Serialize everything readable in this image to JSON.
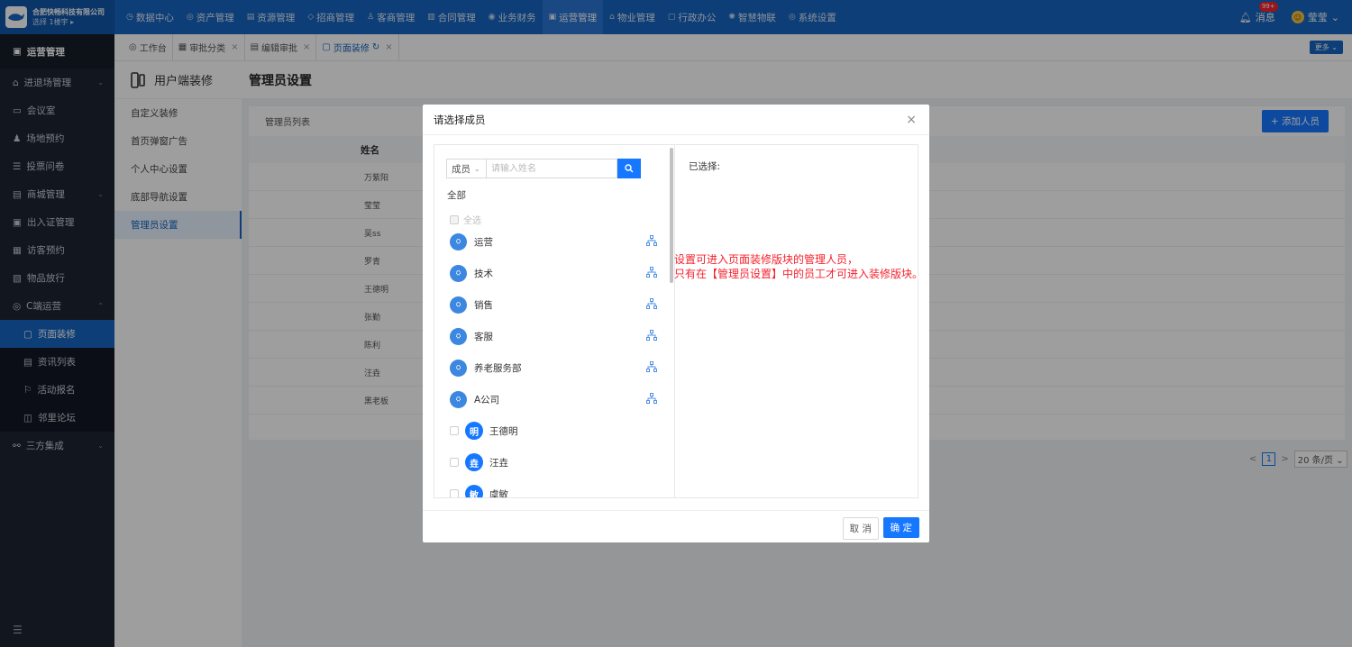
{
  "app": {
    "company": "合肥快畅科技有限公司",
    "building": "选择 1楼宇 ▸"
  },
  "topnav": {
    "items": [
      {
        "icon": "◷",
        "label": "数据中心"
      },
      {
        "icon": "◎",
        "label": "资产管理"
      },
      {
        "icon": "▤",
        "label": "资源管理"
      },
      {
        "icon": "◇",
        "label": "招商管理"
      },
      {
        "icon": "♙",
        "label": "客商管理"
      },
      {
        "icon": "▥",
        "label": "合同管理"
      },
      {
        "icon": "◉",
        "label": "业务财务"
      },
      {
        "icon": "▣",
        "label": "运营管理"
      },
      {
        "icon": "⌂",
        "label": "物业管理"
      },
      {
        "icon": "▢",
        "label": "行政办公"
      },
      {
        "icon": "✺",
        "label": "智慧物联"
      },
      {
        "icon": "◎",
        "label": "系统设置"
      }
    ],
    "active_index": 7,
    "messages_label": "消息",
    "messages_badge": "99+",
    "user_name": "莹莹"
  },
  "sidebar": {
    "header": "运营管理",
    "items": [
      {
        "icon": "⌂",
        "label": "进退场管理",
        "chevron": "⌄"
      },
      {
        "icon": "▭",
        "label": "会议室"
      },
      {
        "icon": "♟",
        "label": "场地预约"
      },
      {
        "icon": "☰",
        "label": "投票问卷"
      },
      {
        "icon": "▤",
        "label": "商城管理",
        "chevron": "⌄"
      },
      {
        "icon": "▣",
        "label": "出入证管理"
      },
      {
        "icon": "▦",
        "label": "访客预约"
      },
      {
        "icon": "▧",
        "label": "物品放行"
      },
      {
        "icon": "◎",
        "label": "C端运营",
        "chevron": "⌃"
      },
      {
        "icon": "▢",
        "label": "页面装修",
        "sub": true,
        "active": true
      },
      {
        "icon": "▤",
        "label": "资讯列表",
        "sub": true
      },
      {
        "icon": "⚐",
        "label": "活动报名",
        "sub": true
      },
      {
        "icon": "◫",
        "label": "邻里论坛",
        "sub": true
      },
      {
        "icon": "⚯",
        "label": "三方集成",
        "chevron": "⌄"
      }
    ],
    "bottom_icon": "☰"
  },
  "tabs": {
    "items": [
      {
        "icon": "◎",
        "label": "工作台",
        "closable": false
      },
      {
        "icon": "▦",
        "label": "审批分类",
        "closable": true
      },
      {
        "icon": "▤",
        "label": "编辑审批",
        "closable": true
      },
      {
        "icon": "▢",
        "label": "页面装修",
        "closable": true,
        "active": true,
        "refresh": "↻"
      }
    ],
    "more": "更多 ⌄"
  },
  "pagehead": {
    "module": "用户端装修",
    "title": "管理员设置"
  },
  "submenu": {
    "items": [
      "自定义装修",
      "首页弹窗广告",
      "个人中心设置",
      "底部导航设置",
      "管理员设置"
    ],
    "active_index": 4
  },
  "main": {
    "list_title": "管理员列表",
    "add_button": "+ 添加人员",
    "col_name": "姓名",
    "rows": [
      "万紫阳",
      "莹莹",
      "吴ss",
      "罗青",
      "王德明",
      "张勤",
      "陈利",
      "汪垚",
      "黑老板"
    ]
  },
  "pager": {
    "prev": "<",
    "page": "1",
    "next": ">",
    "size": "20 条/页 ⌄"
  },
  "modal": {
    "title": "请选择成员",
    "close": "×",
    "search_type": "成员",
    "search_placeholder": "请输入姓名",
    "all_label": "全部",
    "select_all": "全选",
    "departments": [
      "运营",
      "技术",
      "销售",
      "客服",
      "养老服务部",
      "A公司"
    ],
    "members": [
      {
        "avatar": "明",
        "name": "王德明"
      },
      {
        "avatar": "垚",
        "name": "汪垚"
      },
      {
        "avatar": "敏",
        "name": "虞敏"
      }
    ],
    "selected_label": "已选择:",
    "cancel": "取 消",
    "ok": "确 定"
  },
  "annotation": {
    "line1": "设置可进入页面装修版块的管理人员，",
    "line2": "只有在【管理员设置】中的员工才可进入装修版块。"
  }
}
